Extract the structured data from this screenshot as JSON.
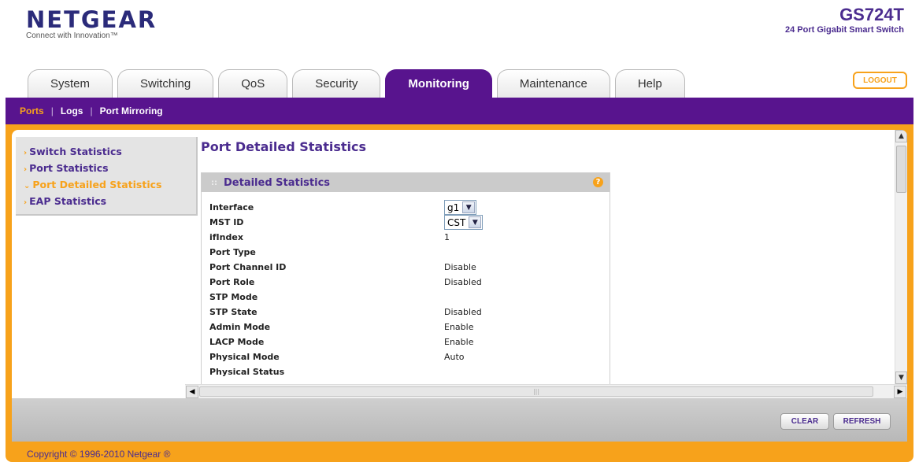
{
  "brand": {
    "logo": "NETGEAR",
    "tagline": "Connect with Innovation™",
    "model": "GS724T",
    "model_desc": "24 Port Gigabit Smart Switch"
  },
  "tabs": [
    {
      "label": "System"
    },
    {
      "label": "Switching"
    },
    {
      "label": "QoS"
    },
    {
      "label": "Security"
    },
    {
      "label": "Monitoring",
      "active": true
    },
    {
      "label": "Maintenance"
    },
    {
      "label": "Help"
    }
  ],
  "logout_label": "LOGOUT",
  "submenu": [
    {
      "label": "Ports",
      "active": true
    },
    {
      "label": "Logs"
    },
    {
      "label": "Port Mirroring"
    }
  ],
  "sidenav": [
    {
      "label": "Switch Statistics"
    },
    {
      "label": "Port Statistics"
    },
    {
      "label": "Port Detailed Statistics",
      "active": true
    },
    {
      "label": "EAP Statistics"
    }
  ],
  "page_title": "Port Detailed Statistics",
  "panel": {
    "title": "Detailed Statistics",
    "help": "?",
    "interface": {
      "label": "Interface",
      "value": "g1"
    },
    "mst_id": {
      "label": "MST ID",
      "value": "CST"
    },
    "rows": [
      {
        "label": "ifIndex",
        "value": "1"
      },
      {
        "label": "Port Type",
        "value": ""
      },
      {
        "label": "Port Channel ID",
        "value": "Disable"
      },
      {
        "label": "Port Role",
        "value": "Disabled"
      },
      {
        "label": "STP Mode",
        "value": ""
      },
      {
        "label": "STP State",
        "value": "Disabled"
      },
      {
        "label": "Admin Mode",
        "value": "Enable"
      },
      {
        "label": "LACP Mode",
        "value": "Enable"
      },
      {
        "label": "Physical Mode",
        "value": "Auto"
      },
      {
        "label": "Physical Status",
        "value": ""
      }
    ]
  },
  "actions": {
    "clear": "CLEAR",
    "refresh": "REFRESH"
  },
  "footer": "Copyright © 1996-2010 Netgear ®",
  "colors": {
    "brand_purple": "#58148e",
    "accent_orange": "#f7a21b",
    "link_purple": "#4b2c8f"
  }
}
